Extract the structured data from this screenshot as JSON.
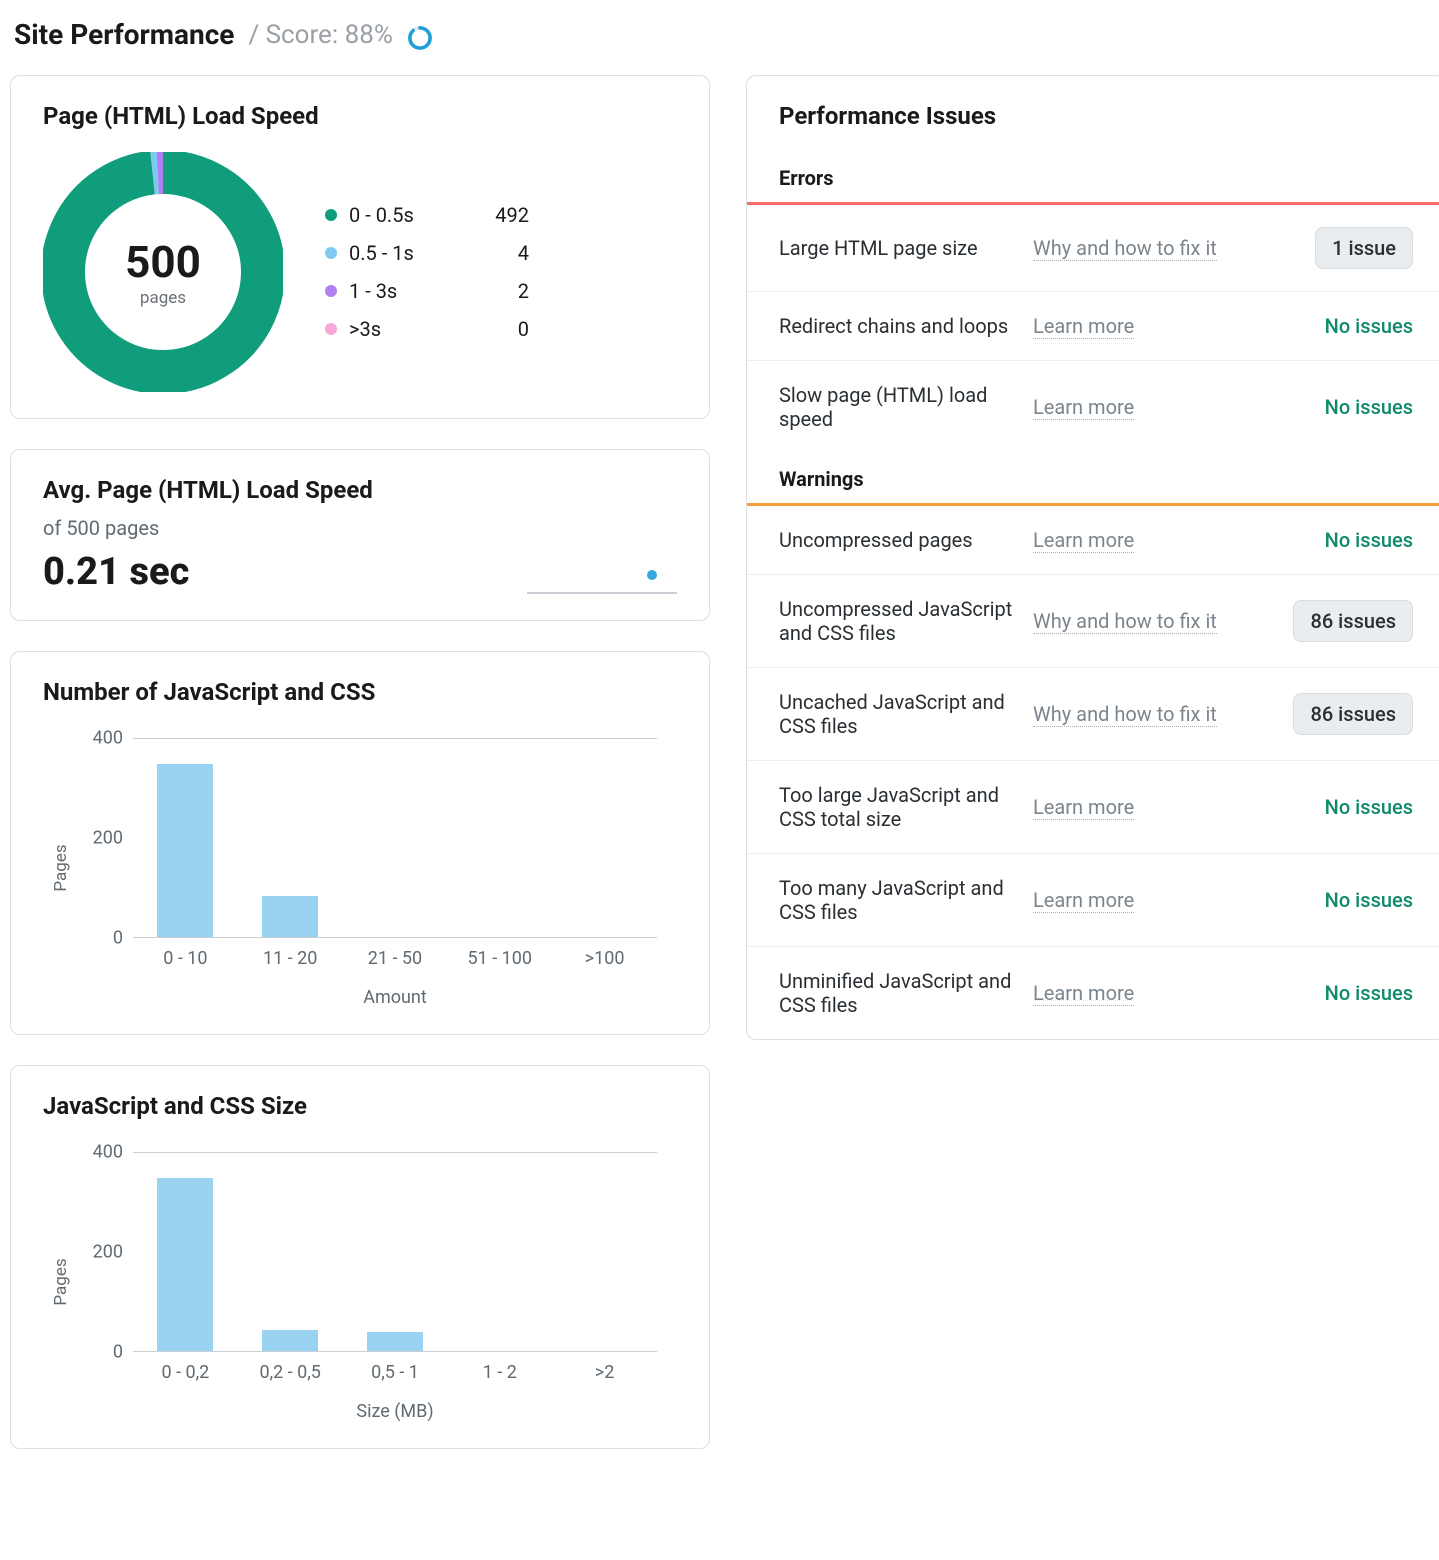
{
  "header": {
    "title": "Site Performance",
    "score_prefix": "/ Score:",
    "score_value": "88%"
  },
  "donut_card": {
    "title": "Page (HTML) Load Speed",
    "center_value": "500",
    "center_label": "pages",
    "legend": [
      {
        "label": "0 - 0.5s",
        "count": "492",
        "color": "#0f9d7c"
      },
      {
        "label": "0.5 - 1s",
        "count": "4",
        "color": "#7ec9ef"
      },
      {
        "label": "1 - 3s",
        "count": "2",
        "color": "#b07ff0"
      },
      {
        "label": ">3s",
        "count": "0",
        "color": "#f7a8d9"
      }
    ]
  },
  "avg_card": {
    "title": "Avg. Page (HTML) Load Speed",
    "subtitle": "of 500 pages",
    "value": "0.21 sec"
  },
  "bar1": {
    "title": "Number of JavaScript and CSS",
    "xlabel": "Amount",
    "ylabel": "Pages",
    "categories": [
      "0 - 10",
      "11 - 20",
      "21 - 50",
      "51 - 100",
      ">100"
    ]
  },
  "bar2": {
    "title": "JavaScript and CSS Size",
    "xlabel": "Size (MB)",
    "ylabel": "Pages",
    "categories": [
      "0 - 0,2",
      "0,2 - 0,5",
      "0,5 - 1",
      "1 - 2",
      ">2"
    ]
  },
  "issues_card": {
    "title": "Performance Issues",
    "errors_label": "Errors",
    "warnings_label": "Warnings",
    "no_issues_label": "No issues",
    "errors": [
      {
        "name": "Large HTML page size",
        "link": "Why and how to fix it",
        "count": 1
      },
      {
        "name": "Redirect chains and loops",
        "link": "Learn more",
        "count": 0
      },
      {
        "name": "Slow page (HTML) load speed",
        "link": "Learn more",
        "count": 0
      }
    ],
    "warnings": [
      {
        "name": "Uncompressed pages",
        "link": "Learn more",
        "count": 0
      },
      {
        "name": "Uncompressed JavaScript and CSS files",
        "link": "Why and how to fix it",
        "count": 86
      },
      {
        "name": "Uncached JavaScript and CSS files",
        "link": "Why and how to fix it",
        "count": 86
      },
      {
        "name": "Too large JavaScript and CSS total size",
        "link": "Learn more",
        "count": 0
      },
      {
        "name": "Too many JavaScript and CSS files",
        "link": "Learn more",
        "count": 0
      },
      {
        "name": "Unminified JavaScript and CSS files",
        "link": "Learn more",
        "count": 0
      }
    ]
  },
  "chart_data": [
    {
      "type": "pie",
      "title": "Page (HTML) Load Speed",
      "total": 500,
      "series": [
        {
          "name": "0 - 0.5s",
          "value": 492
        },
        {
          "name": "0.5 - 1s",
          "value": 4
        },
        {
          "name": "1 - 3s",
          "value": 2
        },
        {
          "name": ">3s",
          "value": 0
        }
      ]
    },
    {
      "type": "bar",
      "title": "Number of JavaScript and CSS",
      "xlabel": "Amount",
      "ylabel": "Pages",
      "ylim": [
        0,
        400
      ],
      "yticks": [
        0,
        200,
        400
      ],
      "categories": [
        "0 - 10",
        "11 - 20",
        "21 - 50",
        "51 - 100",
        ">100"
      ],
      "values": [
        350,
        85,
        0,
        0,
        0
      ]
    },
    {
      "type": "bar",
      "title": "JavaScript and CSS Size",
      "xlabel": "Size (MB)",
      "ylabel": "Pages",
      "ylim": [
        0,
        400
      ],
      "yticks": [
        0,
        200,
        400
      ],
      "categories": [
        "0 - 0,2",
        "0,2 - 0,5",
        "0,5 - 1",
        "1 - 2",
        ">2"
      ],
      "values": [
        350,
        45,
        40,
        0,
        0
      ]
    }
  ]
}
